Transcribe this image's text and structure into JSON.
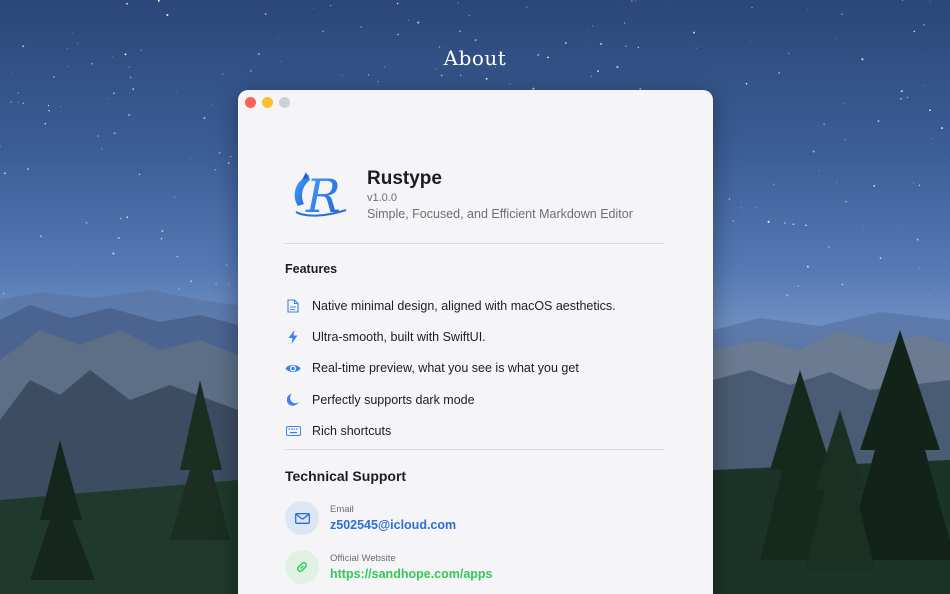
{
  "page": {
    "title": "About"
  },
  "app": {
    "name": "Rustype",
    "version": "v1.0.0",
    "tagline": "Simple, Focused, and Efficient Markdown Editor"
  },
  "features": {
    "title": "Features",
    "items": [
      {
        "icon": "document-icon",
        "label": "Native minimal design, aligned with macOS aesthetics."
      },
      {
        "icon": "bolt-icon",
        "label": "Ultra-smooth, built with SwiftUI."
      },
      {
        "icon": "eye-icon",
        "label": "Real-time preview, what you see is what you get"
      },
      {
        "icon": "moon-icon",
        "label": "Perfectly supports dark mode"
      },
      {
        "icon": "keyboard-icon",
        "label": "Rich shortcuts"
      }
    ]
  },
  "support": {
    "title": "Technical Support",
    "email": {
      "label": "Email",
      "value": "z502545@icloud.com",
      "icon": "envelope-icon"
    },
    "website": {
      "label": "Official Website",
      "value": "https://sandhope.com/apps",
      "icon": "link-icon"
    }
  },
  "colors": {
    "accent_blue": "#2a6fdb",
    "accent_green": "#34c759",
    "icon_blue": "#3b82f6"
  }
}
